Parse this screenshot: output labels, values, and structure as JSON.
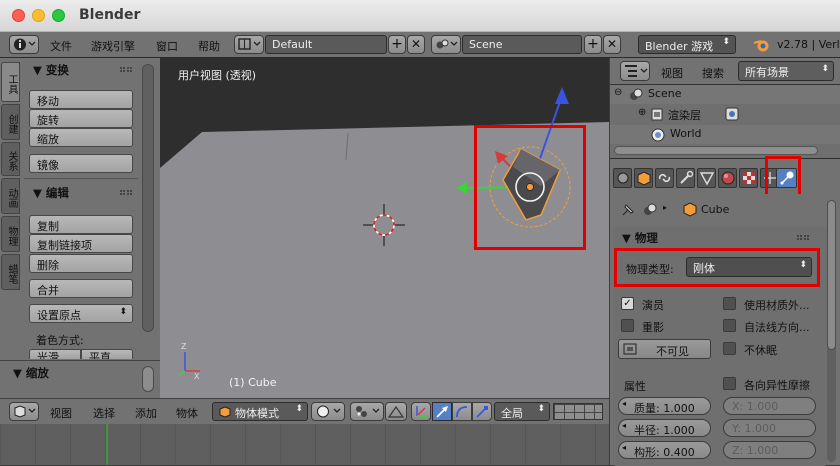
{
  "window": {
    "title": "Blender"
  },
  "menu": {
    "file": "文件",
    "game_engine": "游戏引擎",
    "window": "窗口",
    "help": "帮助"
  },
  "topbar": {
    "screen_layout": "Default",
    "scene": "Scene",
    "engine": "Blender 游戏",
    "version": "v2.78 | Verl"
  },
  "tool_tabs": [
    "工具",
    "创建",
    "关系",
    "动画",
    "物理",
    "蜡笔"
  ],
  "tools": {
    "transform_title": "变换",
    "transform_buttons": [
      "移动",
      "旋转",
      "缩放",
      "镜像"
    ],
    "edit_title": "编辑",
    "edit_buttons": [
      "复制",
      "复制链接项",
      "删除",
      "合并"
    ],
    "set_origin": "设置原点",
    "shading_label": "着色方式:",
    "shading_smooth": "光滑",
    "shading_flat": "平直",
    "scale_title": "缩放"
  },
  "viewport": {
    "label": "用户视图 (透视)",
    "object_label": "(1) Cube",
    "axis_x": "X",
    "axis_z": "Z"
  },
  "view_header": {
    "view": "视图",
    "select": "选择",
    "add": "添加",
    "object": "物体",
    "mode": "物体模式",
    "orientation": "全局"
  },
  "outliner": {
    "view": "视图",
    "search": "搜索",
    "filter": "所有场景",
    "items": [
      {
        "label": "Scene"
      },
      {
        "label": "渲染层"
      },
      {
        "label": "World"
      }
    ]
  },
  "properties": {
    "breadcrumb": "Cube",
    "physics_title": "物理",
    "physics_type_label": "物理类型:",
    "physics_type_value": "刚体",
    "actor": "演员",
    "use_material": "使用材质外...",
    "ghost": "重影",
    "normal_align": "自法线方向...",
    "invisible": "不可见",
    "no_sleep": "不休眠",
    "attributes_title": "属性",
    "anisotropic": "各向异性摩擦",
    "mass": "质量: 1.000",
    "radius": "半径: 1.000",
    "form": "构形: 0.400",
    "ax": "X: 1.000",
    "ay": "Y: 1.000",
    "az": "Z: 1.000"
  },
  "colors": {
    "accent": "#5680c2",
    "highlight": "#e00000",
    "selected": "#f29d3a"
  }
}
